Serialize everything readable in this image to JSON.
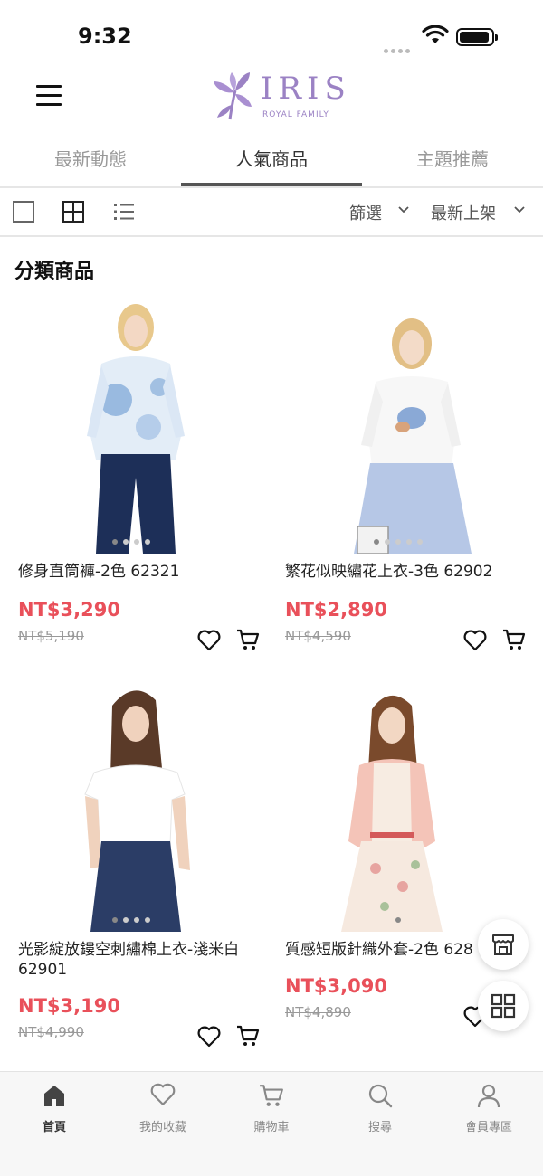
{
  "status_bar": {
    "time": "9:32"
  },
  "header": {
    "logo_text": "IRIS",
    "logo_subtitle": "ROYAL FAMILY",
    "brand_color": "#9b82c4"
  },
  "tabs": [
    {
      "label": "最新動態",
      "active": false
    },
    {
      "label": "人氣商品",
      "active": true
    },
    {
      "label": "主題推薦",
      "active": false
    }
  ],
  "toolbar": {
    "filter_label": "篩選",
    "sort_label": "最新上架"
  },
  "section_title": "分類商品",
  "products": [
    {
      "name": "修身直筒褲-2色 62321",
      "name_line2": "",
      "price": "NT$3,290",
      "original_price": "NT$5,190"
    },
    {
      "name": "繁花似映繡花上衣-3色 62902",
      "name_line2": "",
      "price": "NT$2,890",
      "original_price": "NT$4,590"
    },
    {
      "name": "光影綻放鏤空刺繡棉上衣-淺米白",
      "name_line2": "62901",
      "price": "NT$3,190",
      "original_price": "NT$4,990"
    },
    {
      "name": "質感短版針織外套-2色 628",
      "name_line2": "",
      "price": "NT$3,090",
      "original_price": "NT$4,890"
    }
  ],
  "bottom_nav": [
    {
      "label": "首頁",
      "icon": "home-icon",
      "active": true
    },
    {
      "label": "我的收藏",
      "icon": "heart-icon",
      "active": false
    },
    {
      "label": "購物車",
      "icon": "cart-icon",
      "active": false
    },
    {
      "label": "搜尋",
      "icon": "search-icon",
      "active": false
    },
    {
      "label": "會員專區",
      "icon": "user-icon",
      "active": false
    }
  ],
  "colors": {
    "price": "#e9505a",
    "active_tab_indicator": "#555555"
  }
}
